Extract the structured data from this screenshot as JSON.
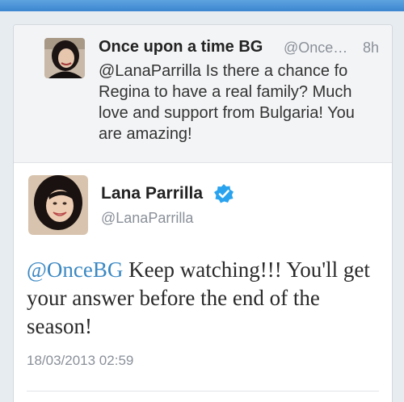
{
  "reply_tweet": {
    "display_name": "Once upon a time BG",
    "handle": "@Once…",
    "time": "8h",
    "text": "@LanaParrilla Is there a chance fo Regina to have a real family? Much love and support from Bulgaria! You are amazing!"
  },
  "main_tweet": {
    "display_name": "Lana Parrilla",
    "handle": "@LanaParrilla",
    "mention": "@OnceBG",
    "text": " Keep watching!!! You'll get your answer before the end of the season!",
    "timestamp": "18/03/2013 02:59"
  },
  "colors": {
    "accent": "#3b88c3",
    "verified_badge": "#2aa3ef",
    "top_bar": "#4a93d8"
  },
  "icons": {
    "verified": "verified-badge-icon"
  }
}
